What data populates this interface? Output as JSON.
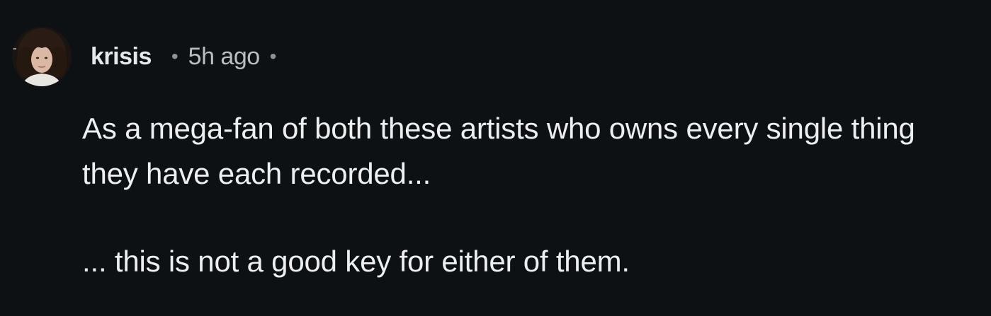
{
  "comment": {
    "author": {
      "username": "krisis",
      "avatar": "avatar-portrait"
    },
    "meta": {
      "separator": "•",
      "timestamp": "5h ago"
    },
    "body": {
      "paragraphs": [
        "As a mega-fan of both these artists who owns every single thing they have each recorded...",
        "... this is not a good key for either of them."
      ]
    }
  },
  "colors": {
    "background": "#0e1114",
    "text_primary": "#e6e8ea",
    "text_secondary": "#b9bec3"
  }
}
